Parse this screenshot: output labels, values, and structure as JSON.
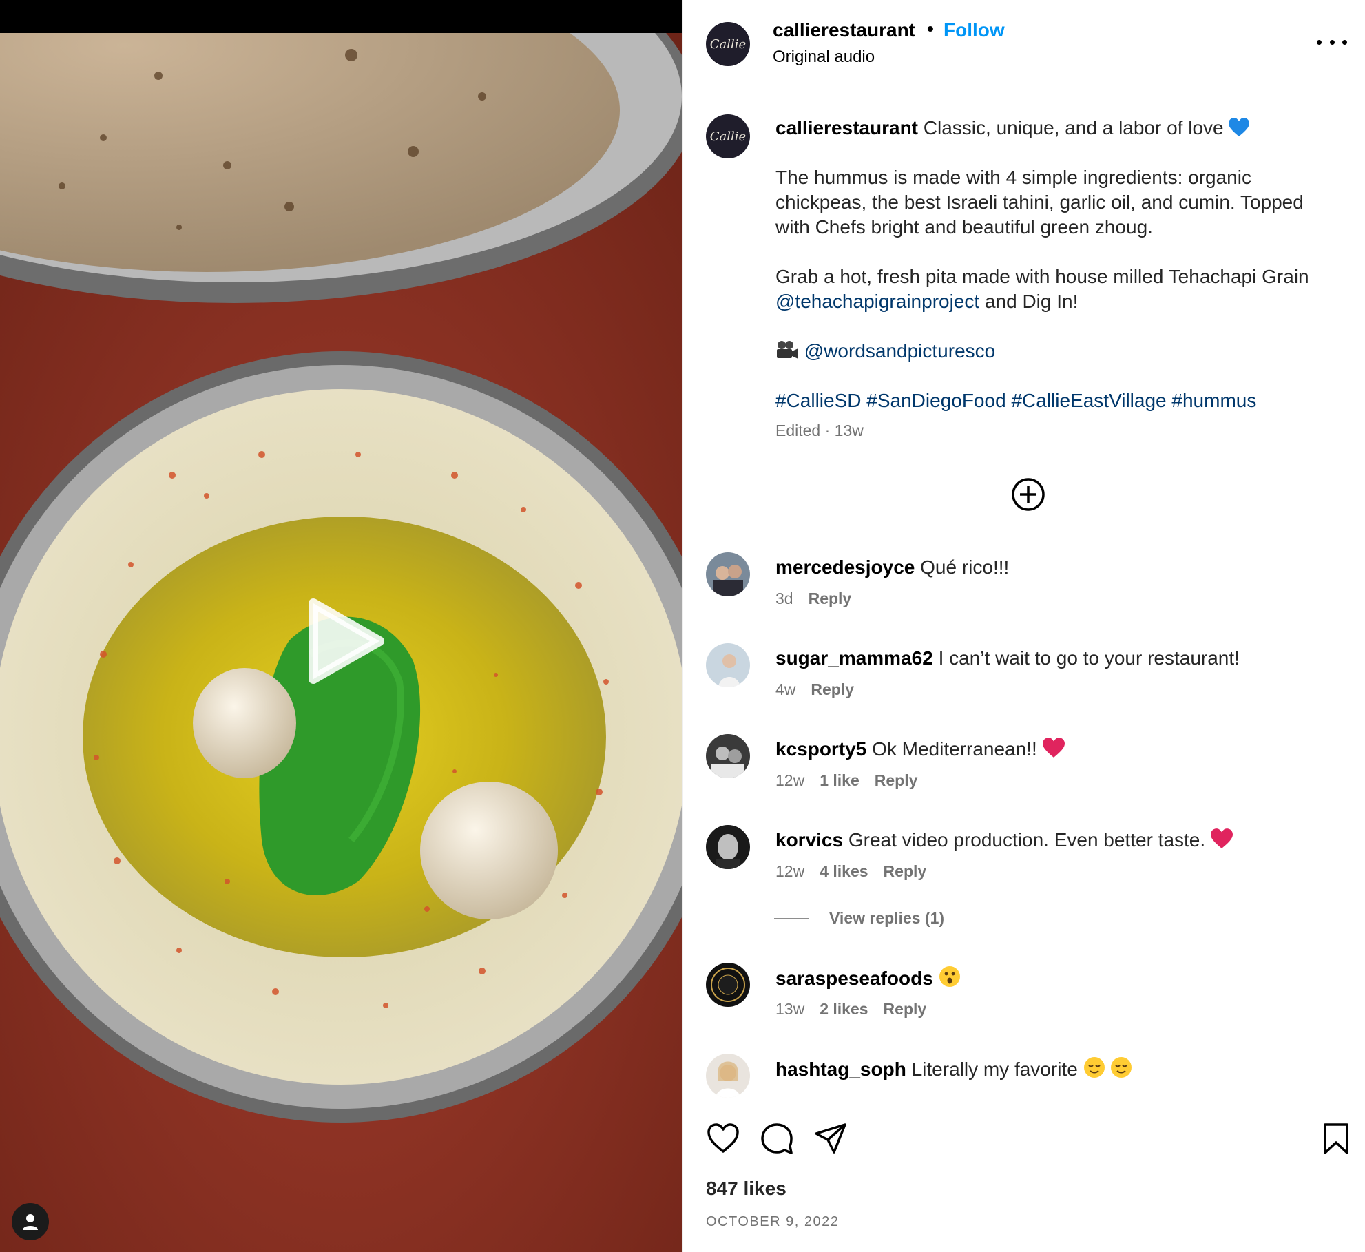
{
  "post": {
    "username": "callierestaurant",
    "avatar_text": "Callie",
    "follow_label": "Follow",
    "separator": "•",
    "audio_label": "Original audio"
  },
  "caption": {
    "username": "callierestaurant",
    "line1": "Classic, unique, and a labor of love",
    "para2": "The hummus is made with 4 simple ingredients: organic chickpeas, the best Israeli tahini, garlic oil, and cumin. Topped with Chefs bright and beautiful green zhoug.",
    "para3_text": "Grab a hot, fresh pita made with house milled Tehachapi Grain",
    "para3_mention": "@tehachapigrainproject",
    "para3_tail": "and Dig In!",
    "credit_mention": "@wordsandpicturesco",
    "hashtags": [
      "#CallieSD",
      "#SanDiegoFood",
      "#CallieEastVillage",
      "#hummus"
    ],
    "edited_label": "Edited",
    "meta_sep": "·",
    "time_ago": "13w"
  },
  "comments": [
    {
      "username": "mercedesjoyce",
      "text": "Qué rico!!!",
      "time": "3d",
      "likes": "",
      "reply": "Reply",
      "emoji": ""
    },
    {
      "username": "sugar_mamma62",
      "text": "I can’t wait to go to your restaurant!",
      "time": "4w",
      "likes": "",
      "reply": "Reply",
      "emoji": ""
    },
    {
      "username": "kcsporty5",
      "text": "Ok Mediterranean!!",
      "time": "12w",
      "likes": "1 like",
      "reply": "Reply",
      "emoji": "heart"
    },
    {
      "username": "korvics",
      "text": "Great video production. Even better taste.",
      "time": "12w",
      "likes": "4 likes",
      "reply": "Reply",
      "emoji": "heart"
    },
    {
      "username": "saraspeseafoods",
      "text": "",
      "time": "13w",
      "likes": "2 likes",
      "reply": "Reply",
      "emoji": "surprised-face"
    },
    {
      "username": "hashtag_soph",
      "text": "Literally my favorite",
      "time": "",
      "likes": "",
      "reply": "",
      "emoji": "relieved-face x2"
    }
  ],
  "view_replies_label": "View replies (1)",
  "stats": {
    "likes_label": "847 likes",
    "date": "OCTOBER 9, 2022"
  },
  "icons": {
    "like": "heart-outline-icon",
    "comment": "comment-bubble-icon",
    "share": "paper-plane-icon",
    "save": "bookmark-icon",
    "more": "more-dots-icon",
    "load_more": "plus-circle-icon",
    "play": "play-icon",
    "user_tag": "person-icon"
  },
  "colors": {
    "follow": "#0095f6",
    "link": "#00376b",
    "muted": "#737373",
    "heart_red": "#e0245e",
    "blue_heart": "#1e88e5"
  }
}
